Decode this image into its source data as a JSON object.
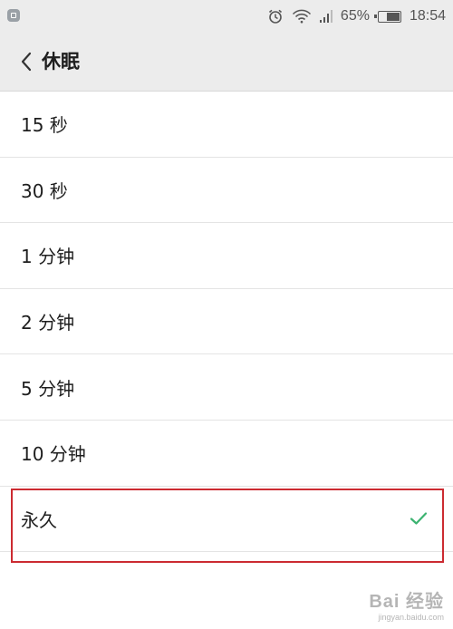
{
  "status_bar": {
    "battery_percent_label": "65%",
    "battery_level": 0.65,
    "time": "18:54",
    "icons": [
      "notification-icon",
      "alarm-icon",
      "wifi-icon",
      "signal-icon",
      "battery-icon"
    ]
  },
  "header": {
    "title": "休眠",
    "back_icon": "chevron-left-icon"
  },
  "options": [
    {
      "label": "15 秒",
      "selected": false
    },
    {
      "label": "30 秒",
      "selected": false
    },
    {
      "label": "1 分钟",
      "selected": false
    },
    {
      "label": "2 分钟",
      "selected": false
    },
    {
      "label": "5 分钟",
      "selected": false
    },
    {
      "label": "10 分钟",
      "selected": false
    },
    {
      "label": "永久",
      "selected": true
    }
  ],
  "colors": {
    "check": "#3cb371",
    "highlight_border": "#cc2b31",
    "header_bg": "#ececec"
  },
  "watermark": {
    "brand": "Bai 经验",
    "domain": "jingyan.baidu.com"
  }
}
